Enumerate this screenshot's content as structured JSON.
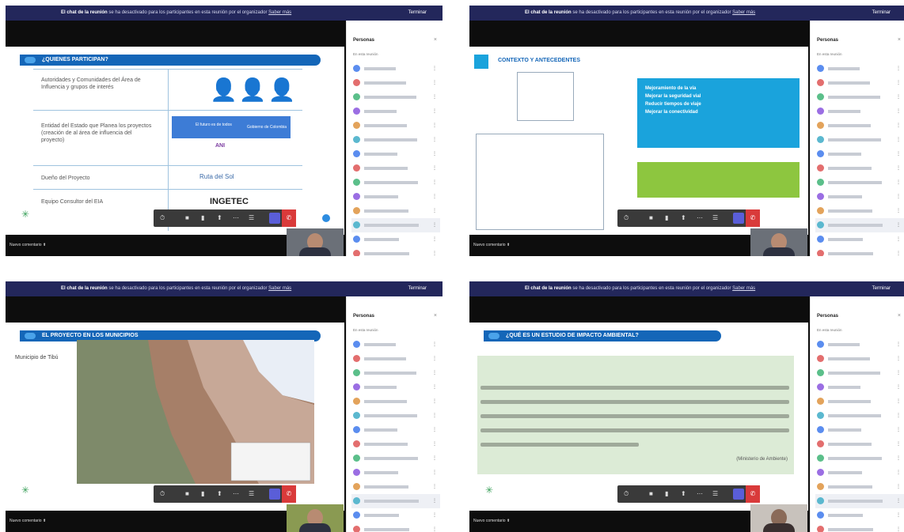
{
  "meeting": {
    "banner_bold": "El chat de la reunión",
    "banner_text": "se ha desactivado para los participantes en esta reunión por el organizador",
    "banner_link": "Saber más",
    "top_button": "Terminar",
    "panel_title": "Personas",
    "panel_close": "×",
    "panel_subtitle": "En esta reunión",
    "bottom_label": "Nuevo comentario ⬆"
  },
  "frames": [
    {
      "slide_title": "¿QUIENES PARTICIPAN?",
      "rows": [
        "Autoridades y Comunidades del Área de Influencia y grupos de interés",
        "Entidad del Estado que Planea los proyectos (creación de al área de influencia del proyecto)",
        "Dueño del Proyecto",
        "Equipo Consultor del EIA"
      ],
      "logos": [
        "El futuro es de todos",
        "Gobierno de Colombia",
        "ANI",
        "Ruta del Sol",
        "INGETEC"
      ]
    },
    {
      "slide_title": "CONTEXTO Y ANTECEDENTES",
      "bullets": [
        "Mejoramiento de la vía",
        "Mejorar la seguridad vial",
        "Reducir tiempos de viaje",
        "Mejorar la conectividad"
      ]
    },
    {
      "slide_title": "EL PROYECTO EN LOS MUNICIPIOS",
      "map_label": "Municipio de Tibú"
    },
    {
      "slide_title": "¿QUÉ ES UN ESTUDIO DE IMPACTO AMBIENTAL?",
      "quote_source": "(Ministerio de Ambiente)"
    }
  ]
}
